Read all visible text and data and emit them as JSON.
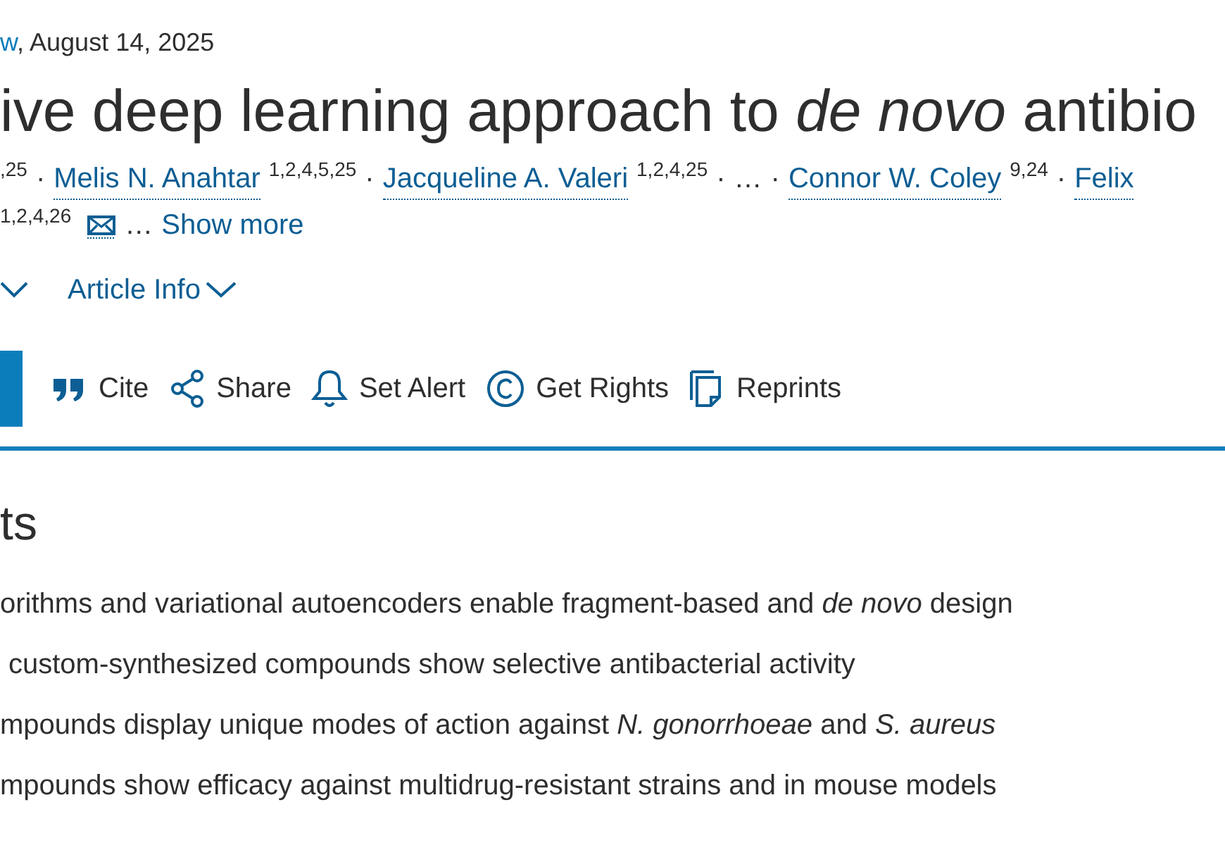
{
  "meta": {
    "link": "w",
    "date": ", August 14, 2025"
  },
  "title": "ive deep learning approach to *de novo* antibio",
  "authors_line1": [
    {
      "kind": "sup",
      "text": ",25"
    },
    {
      "kind": "sep",
      "text": "·"
    },
    {
      "kind": "author",
      "name": "Melis N. Anahtar",
      "sup": "1,2,4,5,25"
    },
    {
      "kind": "sep",
      "text": "·"
    },
    {
      "kind": "author",
      "name": "Jacqueline A. Valeri",
      "sup": "1,2,4,25"
    },
    {
      "kind": "sep",
      "text": "·"
    },
    {
      "kind": "plain",
      "text": "…"
    },
    {
      "kind": "sep",
      "text": "·"
    },
    {
      "kind": "author",
      "name": "Connor W. Coley",
      "sup": "9,24"
    },
    {
      "kind": "sep",
      "text": "·"
    },
    {
      "kind": "author",
      "name": "Felix"
    }
  ],
  "authors_line2": {
    "sup": "1,2,4,26",
    "ellipsis": "…",
    "show_more": "Show more"
  },
  "info_links": [
    "Article Info"
  ],
  "actions": [
    {
      "label": "Cite"
    },
    {
      "label": "Share"
    },
    {
      "label": "Set Alert"
    },
    {
      "label": "Get Rights"
    },
    {
      "label": "Reprints"
    }
  ],
  "highlights": {
    "heading": "ts",
    "items": [
      "orithms and variational autoencoders enable fragment-based and *de novo* design",
      "custom-synthesized compounds show selective antibacterial activity",
      "mpounds display unique modes of action against *N. gonorrhoeae* and *S. aureus*",
      "mpounds show efficacy against multidrug-resistant strains and in mouse models"
    ]
  }
}
